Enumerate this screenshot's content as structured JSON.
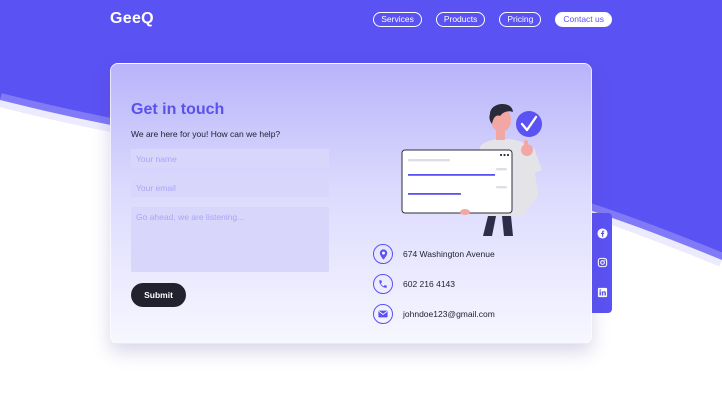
{
  "brand": {
    "logo": "GeeQ"
  },
  "nav": {
    "items": [
      {
        "label": "Services"
      },
      {
        "label": "Products"
      },
      {
        "label": "Pricing"
      },
      {
        "label": "Contact us",
        "active": true
      }
    ]
  },
  "contact_form": {
    "title": "Get in touch",
    "subtitle": "We are here for you! How can we help?",
    "name_placeholder": "Your name",
    "email_placeholder": "Your email",
    "message_placeholder": "Go ahead, we are listening...",
    "name_value": "",
    "email_value": "",
    "message_value": "",
    "submit_label": "Submit"
  },
  "contact_info": {
    "address": "674 Washington Avenue",
    "phone": "602 216 4143",
    "email": "johndoe123@gmail.com"
  },
  "social": {
    "icons": [
      "facebook-icon",
      "instagram-icon",
      "linkedin-icon"
    ]
  },
  "colors": {
    "accent": "#5b52f3",
    "title": "#5a52ea",
    "dark_button": "#22222e",
    "input_bg": "#d9d6fc"
  }
}
